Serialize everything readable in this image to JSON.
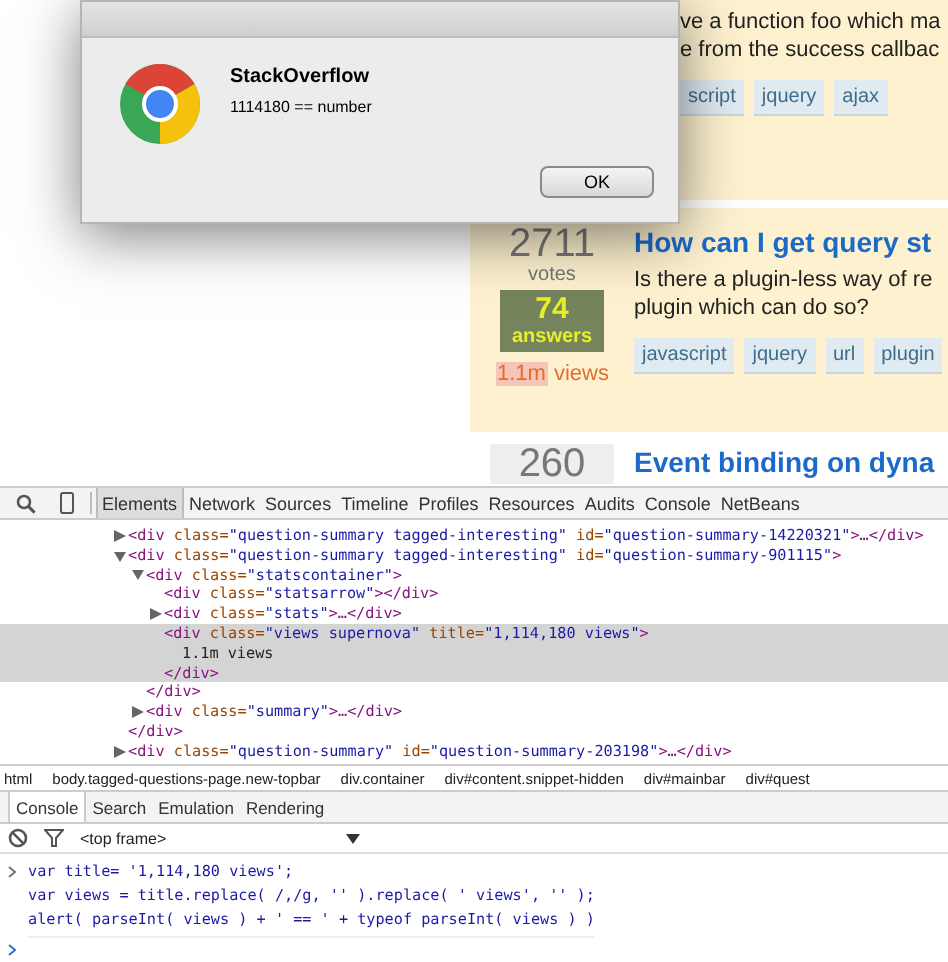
{
  "questions": [
    {
      "excerpt": [
        "ve a function foo which ma",
        "e from the success callbac"
      ],
      "tags": [
        "script",
        "jquery",
        "ajax"
      ]
    },
    {
      "votes": "2711",
      "votes_label": "votes",
      "answers": "74",
      "answers_label": "answers",
      "views_count": "1.1m",
      "views_label": "views",
      "title": "How can I get query st",
      "excerpt": [
        "Is there a plugin-less way of re",
        "plugin which can do so?"
      ],
      "tags": [
        "javascript",
        "jquery",
        "url",
        "plugin"
      ]
    },
    {
      "votes": "260",
      "title": "Event binding on dyna"
    }
  ],
  "dialog": {
    "title": "StackOverflow",
    "message": "1114180 == number",
    "button": "OK"
  },
  "devtools": {
    "tabs": [
      {
        "label": "Elements",
        "selected": true
      },
      {
        "label": "Network",
        "selected": false
      },
      {
        "label": "Sources",
        "selected": false
      },
      {
        "label": "Timeline",
        "selected": false
      },
      {
        "label": "Profiles",
        "selected": false
      },
      {
        "label": "Resources",
        "selected": false
      },
      {
        "label": "Audits",
        "selected": false
      },
      {
        "label": "Console",
        "selected": false
      },
      {
        "label": "NetBeans",
        "selected": false
      }
    ],
    "dom_tree": [
      {
        "kind": "element",
        "text": "<div class=\"question-summary tagged-interesting\" id=\"question-summary-14220321\">…</div>",
        "expanded": false,
        "selected": false
      },
      {
        "kind": "element",
        "text": "<div class=\"question-summary tagged-interesting\" id=\"question-summary-901115\">",
        "expanded": true,
        "selected": false,
        "closing": "</div>",
        "children": [
          {
            "kind": "element",
            "text": "<div class=\"statscontainer\">",
            "expanded": true,
            "selected": false,
            "closing": "</div>",
            "children": [
              {
                "kind": "element",
                "text": "<div class=\"statsarrow\"></div>",
                "selected": false
              },
              {
                "kind": "element",
                "text": "<div class=\"stats\">…</div>",
                "expanded": false,
                "selected": false
              },
              {
                "kind": "element",
                "text": "<div class=\"views supernova\" title=\"1,114,180 views\">",
                "selected": true,
                "closing": "</div>",
                "children": [
                  {
                    "kind": "text",
                    "text": "1.1m views"
                  }
                ]
              }
            ]
          },
          {
            "kind": "element",
            "text": "<div class=\"summary\">…</div>",
            "expanded": false,
            "selected": false
          }
        ]
      },
      {
        "kind": "element",
        "text": "<div class=\"question-summary\" id=\"question-summary-203198\">…</div>",
        "expanded": false,
        "selected": false
      }
    ],
    "breadcrumbs": [
      "html",
      "body.tagged-questions-page.new-topbar",
      "div.container",
      "div#content.snippet-hidden",
      "div#mainbar",
      "div#quest"
    ],
    "drawer_tabs": [
      {
        "label": "Console",
        "selected": true
      },
      {
        "label": "Search",
        "selected": false
      },
      {
        "label": "Emulation",
        "selected": false
      },
      {
        "label": "Rendering",
        "selected": false
      }
    ],
    "frame_select": "<top frame>",
    "console_input": [
      "var title= '1,114,180 views';",
      "var views = title.replace( /,/g, '' ).replace( ' views', '' );",
      "alert( parseInt( views ) + ' == ' + typeof parseInt( views ) )"
    ]
  }
}
